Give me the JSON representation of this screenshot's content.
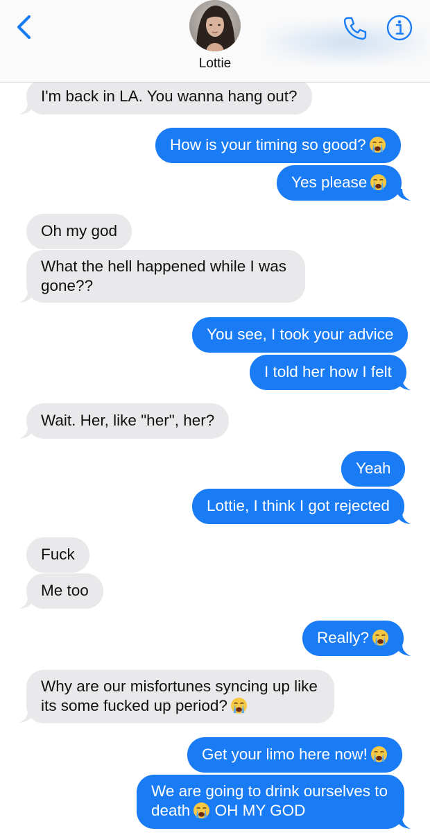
{
  "header": {
    "contact_name": "Lottie",
    "back_icon": "chevron-left-icon",
    "phone_icon": "phone-icon",
    "info_icon": "info-icon",
    "accent_color": "#1a7cf5"
  },
  "messages": [
    {
      "side": "in",
      "text": "I'm back in LA. You wanna hang out?"
    },
    {
      "side": "out",
      "text": "How is your timing so good?",
      "emoji": "crying-face"
    },
    {
      "side": "out",
      "text": "Yes please",
      "emoji": "crying-face"
    },
    {
      "side": "in",
      "text": "Oh my god"
    },
    {
      "side": "in",
      "text": "What the hell happened while I was gone??"
    },
    {
      "side": "out",
      "text": "You see, I took your advice"
    },
    {
      "side": "out",
      "text": "I told her how I felt"
    },
    {
      "side": "in",
      "text": "Wait. Her, like \"her\", her?"
    },
    {
      "side": "out",
      "text": "Yeah"
    },
    {
      "side": "out",
      "text": "Lottie, I think I got rejected"
    },
    {
      "side": "in",
      "text": "Fuck"
    },
    {
      "side": "in",
      "text": "Me too"
    },
    {
      "side": "out",
      "text": "Really?",
      "emoji": "crying-face"
    },
    {
      "side": "in",
      "text": "Why are our misfortunes syncing up like its some fucked up period?",
      "emoji": "crying-face"
    },
    {
      "side": "out",
      "text": "Get your limo here now!",
      "emoji": "crying-face"
    },
    {
      "side": "out",
      "text_a": "We are going to drink ourselves to death",
      "emoji": "crying-face",
      "text_b": "OH MY GOD"
    }
  ],
  "colors": {
    "incoming_bubble": "#e9e9eb",
    "outgoing_bubble": "#1a7cf5"
  }
}
